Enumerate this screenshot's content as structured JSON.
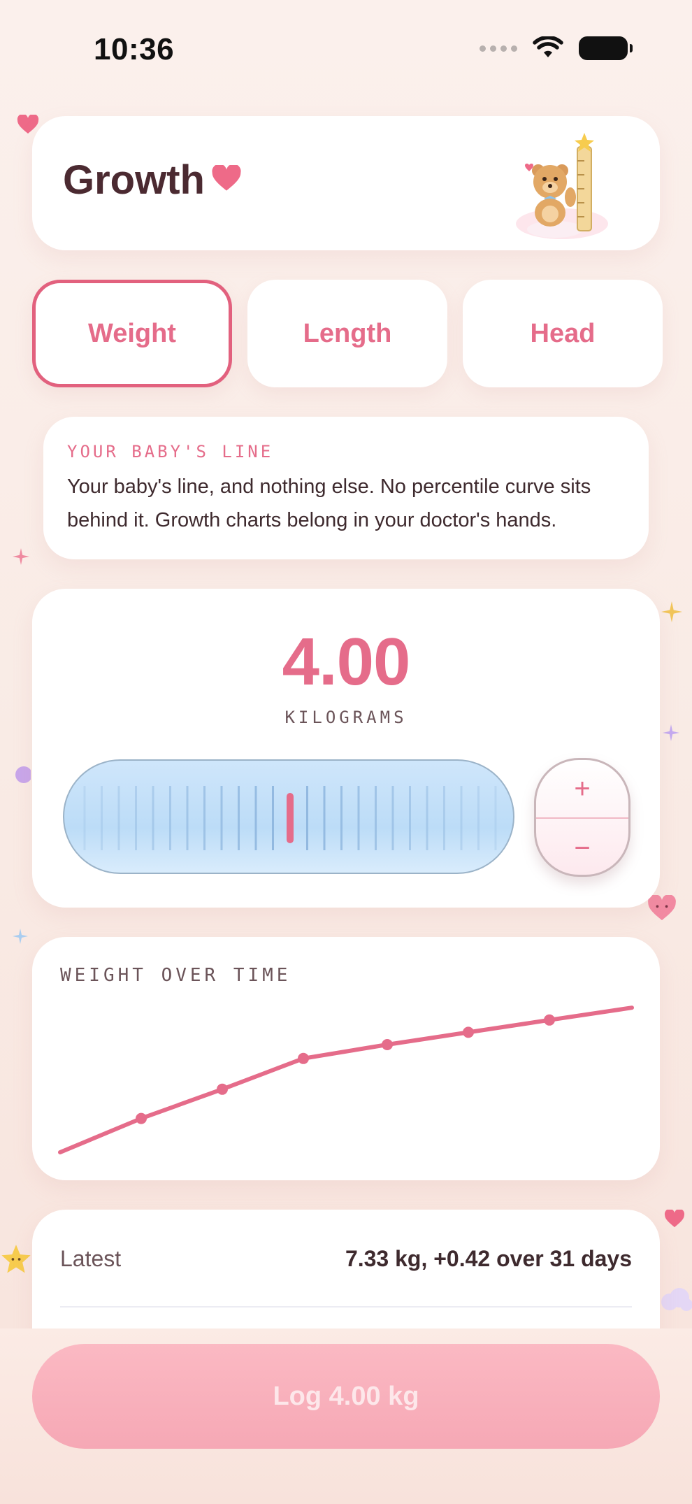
{
  "status_bar": {
    "time": "10:36"
  },
  "header": {
    "title": "Growth"
  },
  "tabs": [
    {
      "label": "Weight",
      "active": true
    },
    {
      "label": "Length",
      "active": false
    },
    {
      "label": "Head",
      "active": false
    }
  ],
  "info": {
    "heading": "YOUR BABY'S LINE",
    "body": "Your baby's line, and nothing else. No percentile curve sits behind it. Growth charts belong in your doctor's hands."
  },
  "entry": {
    "value": "4.00",
    "unit": "KILOGRAMS",
    "stepper_plus": "+",
    "stepper_minus": "−"
  },
  "chart_data": {
    "type": "line",
    "title": "WEIGHT OVER TIME",
    "series": [
      {
        "values": [
          0.0,
          0.22,
          0.41,
          0.61,
          0.7,
          0.78,
          0.86,
          0.94
        ]
      }
    ],
    "markers": [
      1,
      2,
      3,
      4,
      5,
      6
    ],
    "grid": false,
    "color": "#e56c8a"
  },
  "latest": {
    "label": "Latest",
    "value": "7.33 kg, +0.42 over 31 days"
  },
  "log_button": {
    "label": "Log 4.00 kg"
  },
  "colors": {
    "accent": "#e56c8a",
    "ruler_fill": "#c7e1f9",
    "button_fill": "#f7aebb"
  }
}
